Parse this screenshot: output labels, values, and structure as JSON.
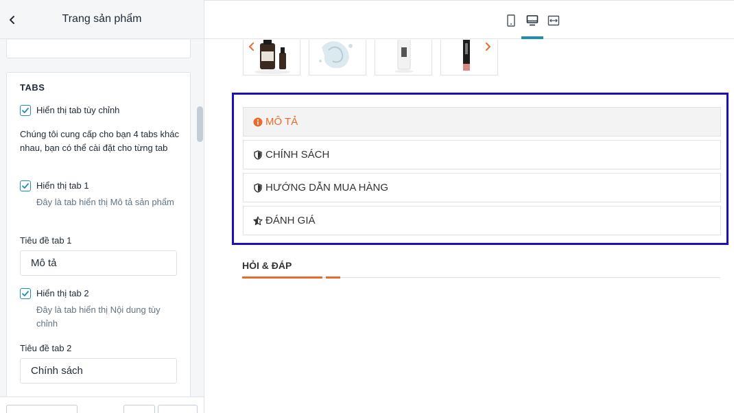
{
  "header": {
    "title": "Trang sản phẩm"
  },
  "section": {
    "title": "TABS",
    "show_custom_tab": {
      "label": "Hiển thị tab tùy chỉnh",
      "checked": true
    },
    "description": "Chúng tôi cung cấp cho bạn 4 tabs khác nhau, bạn có thể cài đặt cho từng tab",
    "tab1": {
      "show_label": "Hiển thị tab 1",
      "checked": true,
      "help": "Đây là tab hiển thị Mô tả sản phẩm",
      "title_label": "Tiêu đề tab 1",
      "title_value": "Mô tả"
    },
    "tab2": {
      "show_label": "Hiển thị tab 2",
      "checked": true,
      "help": "Đây là tab hiển thị Nội dung tùy chỉnh",
      "title_label": "Tiêu đề tab 2",
      "title_value": "Chính sách"
    }
  },
  "toolbar": {
    "devices": [
      "mobile-icon",
      "desktop-icon",
      "fullwidth-icon"
    ],
    "active_device": "desktop"
  },
  "preview": {
    "tabs": [
      {
        "label": "MÔ TẢ",
        "icon": "info-circle-icon",
        "active": true
      },
      {
        "label": "CHÍNH SÁCH",
        "icon": "shield-icon",
        "active": false
      },
      {
        "label": "HƯỚNG DẪN MUA HÀNG",
        "icon": "shield-icon",
        "active": false
      },
      {
        "label": "ĐÁNH GIÁ",
        "icon": "star-half-icon",
        "active": false
      }
    ],
    "qa_title": "HỎI & ĐÁP"
  },
  "colors": {
    "accent": "#1f8bb8",
    "brand_orange": "#e86b2b",
    "highlight_border": "#1a10b8"
  }
}
